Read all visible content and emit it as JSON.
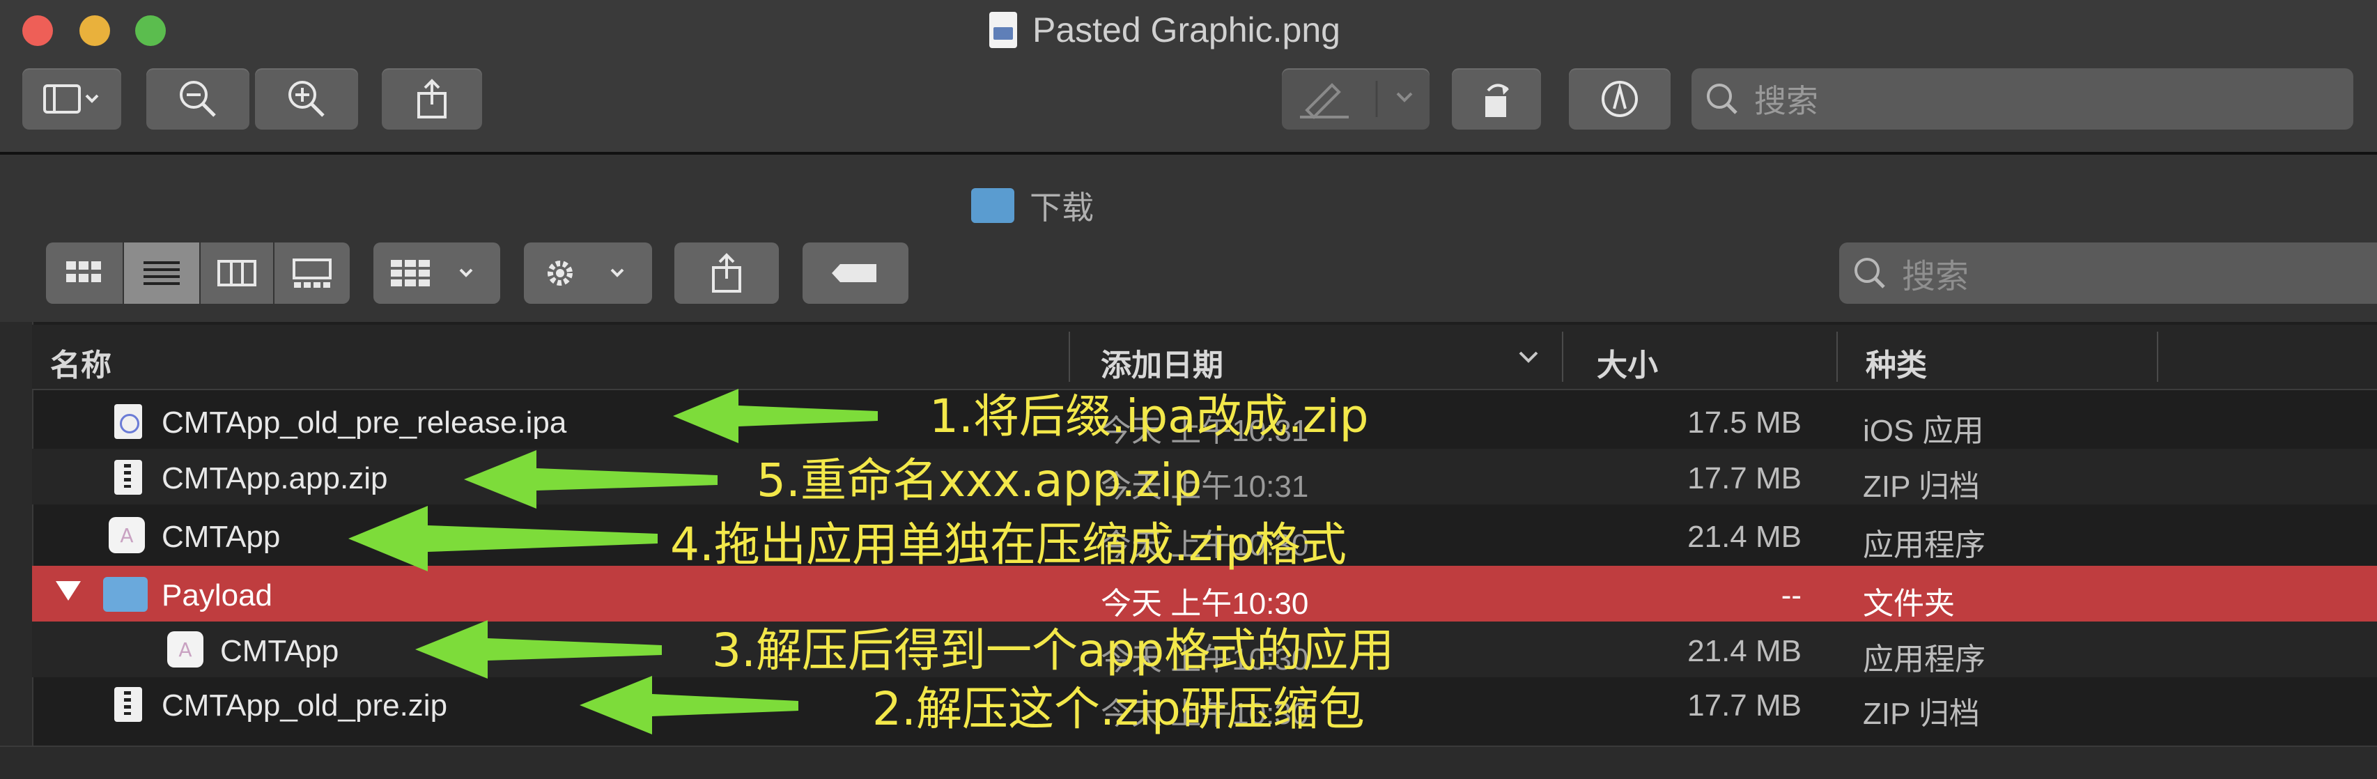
{
  "window": {
    "title": "Pasted Graphic.png"
  },
  "toolbar": {
    "search_placeholder": "搜索"
  },
  "finder": {
    "folder_title": "下载",
    "search_placeholder": "搜索",
    "columns": {
      "name": "名称",
      "date": "添加日期",
      "size": "大小",
      "kind": "种类"
    },
    "rows": [
      {
        "name": "CMTApp_old_pre_release.ipa",
        "date": "今天 上午10:31",
        "size": "17.5 MB",
        "kind": "iOS 应用"
      },
      {
        "name": "CMTApp.app.zip",
        "date": "今天 上午10:31",
        "size": "17.7 MB",
        "kind": "ZIP 归档"
      },
      {
        "name": "CMTApp",
        "date": "今天 上午10:30",
        "size": "21.4 MB",
        "kind": "应用程序"
      },
      {
        "name": "Payload",
        "date": "今天 上午10:30",
        "size": "--",
        "kind": "文件夹"
      },
      {
        "name": "CMTApp",
        "date": "今天 上午10:30",
        "size": "21.4 MB",
        "kind": "应用程序"
      },
      {
        "name": "CMTApp_old_pre.zip",
        "date": "今天 上午10:30",
        "size": "17.7 MB",
        "kind": "ZIP 归档"
      }
    ]
  },
  "annotations": [
    "1.将后缀.ipa改成.zip",
    "5.重命名xxx.app.zip",
    "4.拖出应用单独在压缩成.zip格式",
    "3.解压后得到一个app格式的应用",
    "2.解压这个.zip研压缩包"
  ],
  "colors": {
    "selected_row": "#bf3d3f",
    "annotation_text": "#f3e84a",
    "arrow": "#7ddc3a"
  }
}
